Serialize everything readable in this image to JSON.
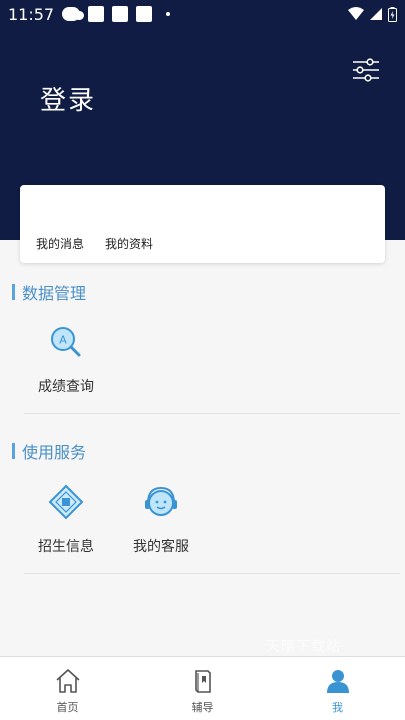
{
  "status_bar": {
    "time": "11:57"
  },
  "header": {
    "title": "登录"
  },
  "card": {
    "messages_label": "我的消息",
    "profile_label": "我的资料"
  },
  "sections": [
    {
      "title": "数据管理",
      "items": [
        {
          "label": "成绩查询",
          "icon": "score-search-icon"
        }
      ]
    },
    {
      "title": "使用服务",
      "items": [
        {
          "label": "招生信息",
          "icon": "admission-info-icon"
        },
        {
          "label": "我的客服",
          "icon": "customer-service-icon"
        }
      ]
    }
  ],
  "watermark": "天晴下载站",
  "tabbar": {
    "tabs": [
      {
        "label": "首页",
        "icon": "home-icon"
      },
      {
        "label": "辅导",
        "icon": "book-icon"
      },
      {
        "label": "我",
        "icon": "user-icon"
      }
    ],
    "active_index": 2
  },
  "colors": {
    "header_bg": "#101c44",
    "accent": "#4a90c9",
    "active_tab": "#3a94d4"
  }
}
